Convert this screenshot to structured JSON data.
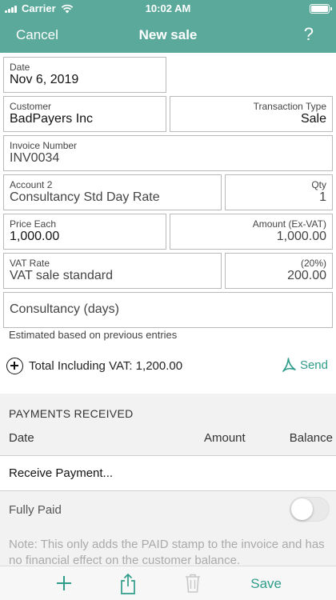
{
  "status": {
    "carrier": "Carrier",
    "time": "10:02 AM"
  },
  "nav": {
    "cancel": "Cancel",
    "title": "New sale",
    "help": "?"
  },
  "form": {
    "date": {
      "label": "Date",
      "value": "Nov 6, 2019"
    },
    "customer": {
      "label": "Customer",
      "value": "BadPayers Inc"
    },
    "transaction_type": {
      "label": "Transaction Type",
      "value": "Sale"
    },
    "invoice_number": {
      "label": "Invoice Number",
      "value": "INV0034"
    },
    "account": {
      "label": "Account 2",
      "value": "Consultancy Std Day Rate"
    },
    "qty": {
      "label": "Qty",
      "value": "1"
    },
    "price_each": {
      "label": "Price Each",
      "value": "1,000.00"
    },
    "amount": {
      "label": "Amount (Ex-VAT)",
      "value": "1,000.00"
    },
    "vat_rate": {
      "label": "VAT Rate",
      "value": "VAT sale standard"
    },
    "vat_amount": {
      "label": "(20%)",
      "value": "200.00"
    },
    "description": "Consultancy (days)"
  },
  "estimated_note": "Estimated based on previous entries",
  "total": {
    "text": "Total Including VAT: 1,200.00",
    "send_label": "Send"
  },
  "payments": {
    "header": "PAYMENTS RECEIVED",
    "columns": [
      "Date",
      "Amount",
      "Balance"
    ],
    "receive_label": "Receive Payment...",
    "fully_paid_label": "Fully Paid",
    "fully_paid_on": false,
    "note": "Note: This only adds the PAID stamp to the invoice and has no financial effect on the customer balance."
  },
  "toolbar": {
    "save_label": "Save"
  },
  "colors": {
    "accent": "#5aa99b",
    "link": "#2f9d8a"
  },
  "icons": [
    "wifi-icon",
    "battery-icon",
    "plus-circle-icon",
    "pdf-icon",
    "add-icon",
    "share-icon",
    "trash-icon"
  ]
}
